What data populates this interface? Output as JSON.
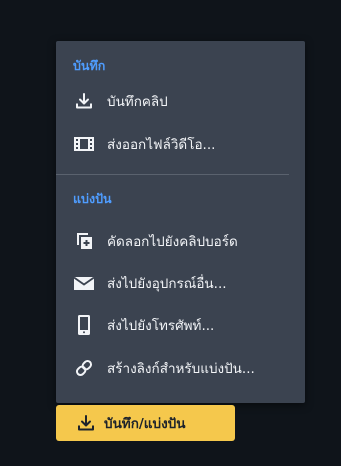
{
  "menu": {
    "sections": [
      {
        "title": "บันทึก",
        "items": [
          {
            "label": "บันทึกคลิป",
            "icon": "download-icon"
          },
          {
            "label": "ส่งออกไฟล์วิดีโอ...",
            "icon": "film-icon"
          }
        ]
      },
      {
        "title": "แบ่งปัน",
        "items": [
          {
            "label": "คัดลอกไปยังคลิปบอร์ด",
            "icon": "copy-to-clipboard-icon"
          },
          {
            "label": "ส่งไปยังอุปกรณ์อื่น...",
            "icon": "envelope-icon"
          },
          {
            "label": "ส่งไปยังโทรศัพท์...",
            "icon": "phone-icon"
          },
          {
            "label": "สร้างลิงก์สำหรับแบ่งปัน...",
            "icon": "link-icon"
          }
        ]
      }
    ]
  },
  "button": {
    "label": "บันทึก/แบ่งปัน",
    "icon": "download-icon"
  },
  "colors": {
    "background": "#0f141a",
    "menu_background": "#3b4350",
    "section_title": "#4f9dff",
    "item_text": "#f2f4f7",
    "button_background": "#f5c84c",
    "button_text": "#1d232b"
  }
}
